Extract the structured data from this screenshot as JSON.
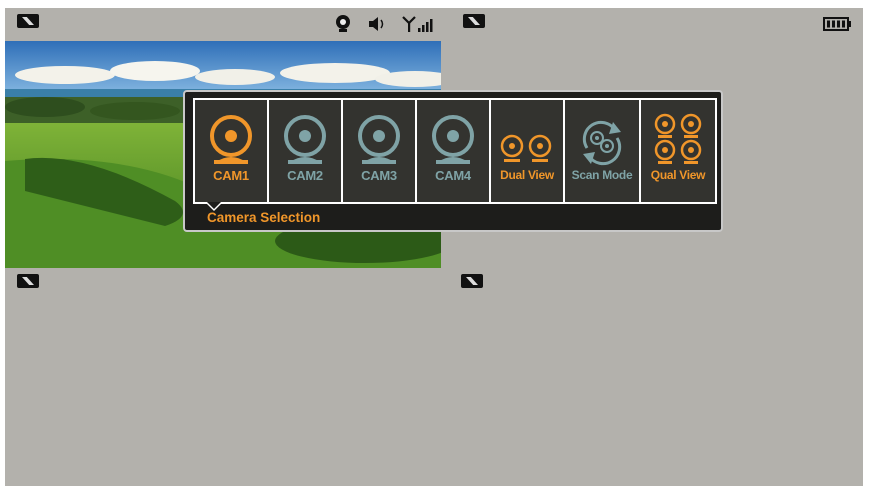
{
  "colors": {
    "screen_bg": "#b3b1ac",
    "active": "#f0962a",
    "inactive": "#7fa3a6",
    "popup_bg": "#1d1d1b"
  },
  "statusbar": {
    "icons": [
      "channel-off-icon",
      "webcam-icon",
      "speaker-icon",
      "signal-icon",
      "channel-off-icon",
      "battery-icon"
    ]
  },
  "camera_popup": {
    "title": "Camera Selection",
    "options": [
      {
        "label": "CAM1",
        "icon": "camera-icon",
        "active": true
      },
      {
        "label": "CAM2",
        "icon": "camera-icon",
        "active": false
      },
      {
        "label": "CAM3",
        "icon": "camera-icon",
        "active": false
      },
      {
        "label": "CAM4",
        "icon": "camera-icon",
        "active": false
      },
      {
        "label": "Dual View",
        "icon": "dual-camera-icon",
        "active": true
      },
      {
        "label": "Scan Mode",
        "icon": "scan-mode-icon",
        "active": false
      },
      {
        "label": "Qual View",
        "icon": "quad-camera-icon",
        "active": true
      }
    ]
  },
  "channels": [
    {
      "name": "channel-1",
      "state": "live"
    },
    {
      "name": "channel-2",
      "state": "off"
    },
    {
      "name": "channel-3",
      "state": "off"
    },
    {
      "name": "channel-4",
      "state": "off"
    }
  ]
}
